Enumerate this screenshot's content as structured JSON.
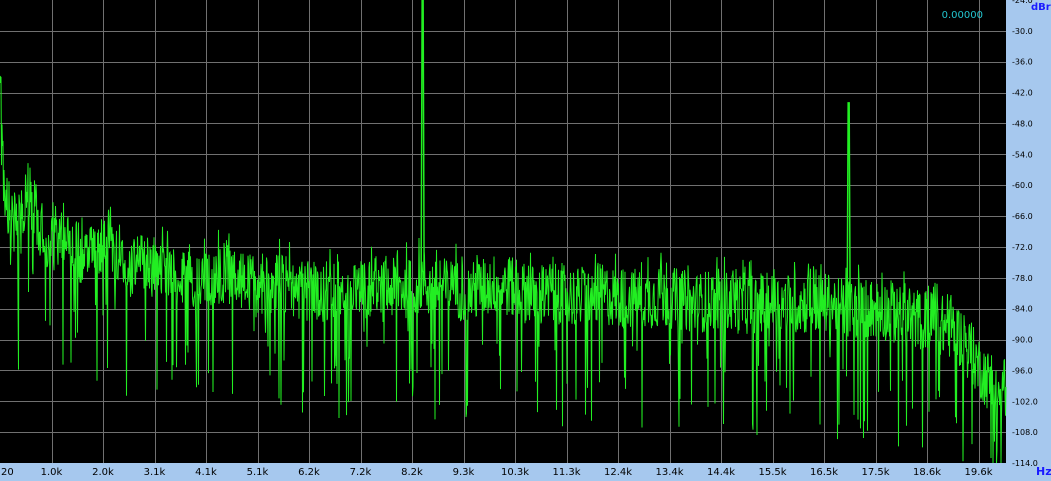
{
  "chart_data": {
    "type": "line",
    "title": "",
    "xlabel": "Hz",
    "ylabel": "dBr",
    "xlim": [
      20,
      20800
    ],
    "ylim": [
      -114,
      -24
    ],
    "grid": true,
    "readout": "0.00000",
    "x_ticks": [
      "20",
      "1.0k",
      "2.0k",
      "3.1k",
      "4.1k",
      "5.1k",
      "6.2k",
      "7.2k",
      "8.2k",
      "9.3k",
      "10.3k",
      "11.3k",
      "12.4k",
      "13.4k",
      "14.4k",
      "15.5k",
      "16.5k",
      "17.5k",
      "18.6k",
      "19.6k"
    ],
    "y_ticks": [
      "-24.0",
      "-30.0",
      "-36.0",
      "-42.0",
      "-48.0",
      "-54.0",
      "-60.0",
      "-66.0",
      "-72.0",
      "-78.0",
      "-84.0",
      "-90.0",
      "-96.0",
      "-102.0",
      "-108.0",
      "-114.0"
    ],
    "series": [
      {
        "color": "#22ee22",
        "x": [
          20,
          70,
          140,
          240,
          400,
          600,
          850,
          1100,
          1400,
          1700,
          2000,
          2300,
          2600,
          3000,
          3400,
          3800,
          4200,
          4600,
          5000,
          5400,
          5800,
          6200,
          6600,
          7000,
          7400,
          7800,
          8200,
          8500,
          8700,
          8750,
          8800,
          8850,
          8900,
          9100,
          9400,
          9700,
          10000,
          10300,
          10600,
          10900,
          11200,
          11600,
          12000,
          12400,
          12800,
          13200,
          13600,
          14000,
          14400,
          14800,
          15200,
          15600,
          16000,
          16400,
          16800,
          17200,
          17500,
          17550,
          17600,
          17650,
          17700,
          17900,
          18200,
          18500,
          18800,
          19100,
          19400,
          19700,
          19900,
          20100,
          20300,
          20500,
          20700
        ],
        "y": [
          -42,
          -56,
          -62,
          -66,
          -70,
          -61,
          -68,
          -72,
          -70,
          -74,
          -73,
          -72,
          -76,
          -75,
          -77,
          -78,
          -79,
          -77,
          -79,
          -80,
          -79,
          -80,
          -81,
          -80,
          -80,
          -81,
          -80,
          -80,
          -79,
          -24,
          -78,
          -80,
          -80,
          -80,
          -80,
          -81,
          -80,
          -79,
          -80,
          -81,
          -82,
          -81,
          -82,
          -81,
          -82,
          -82,
          -82,
          -82,
          -83,
          -82,
          -83,
          -83,
          -83,
          -83,
          -83,
          -83,
          -84,
          -44,
          -84,
          -84,
          -84,
          -84,
          -84,
          -85,
          -86,
          -86,
          -87,
          -88,
          -90,
          -93,
          -96,
          -99,
          -101
        ]
      }
    ]
  }
}
